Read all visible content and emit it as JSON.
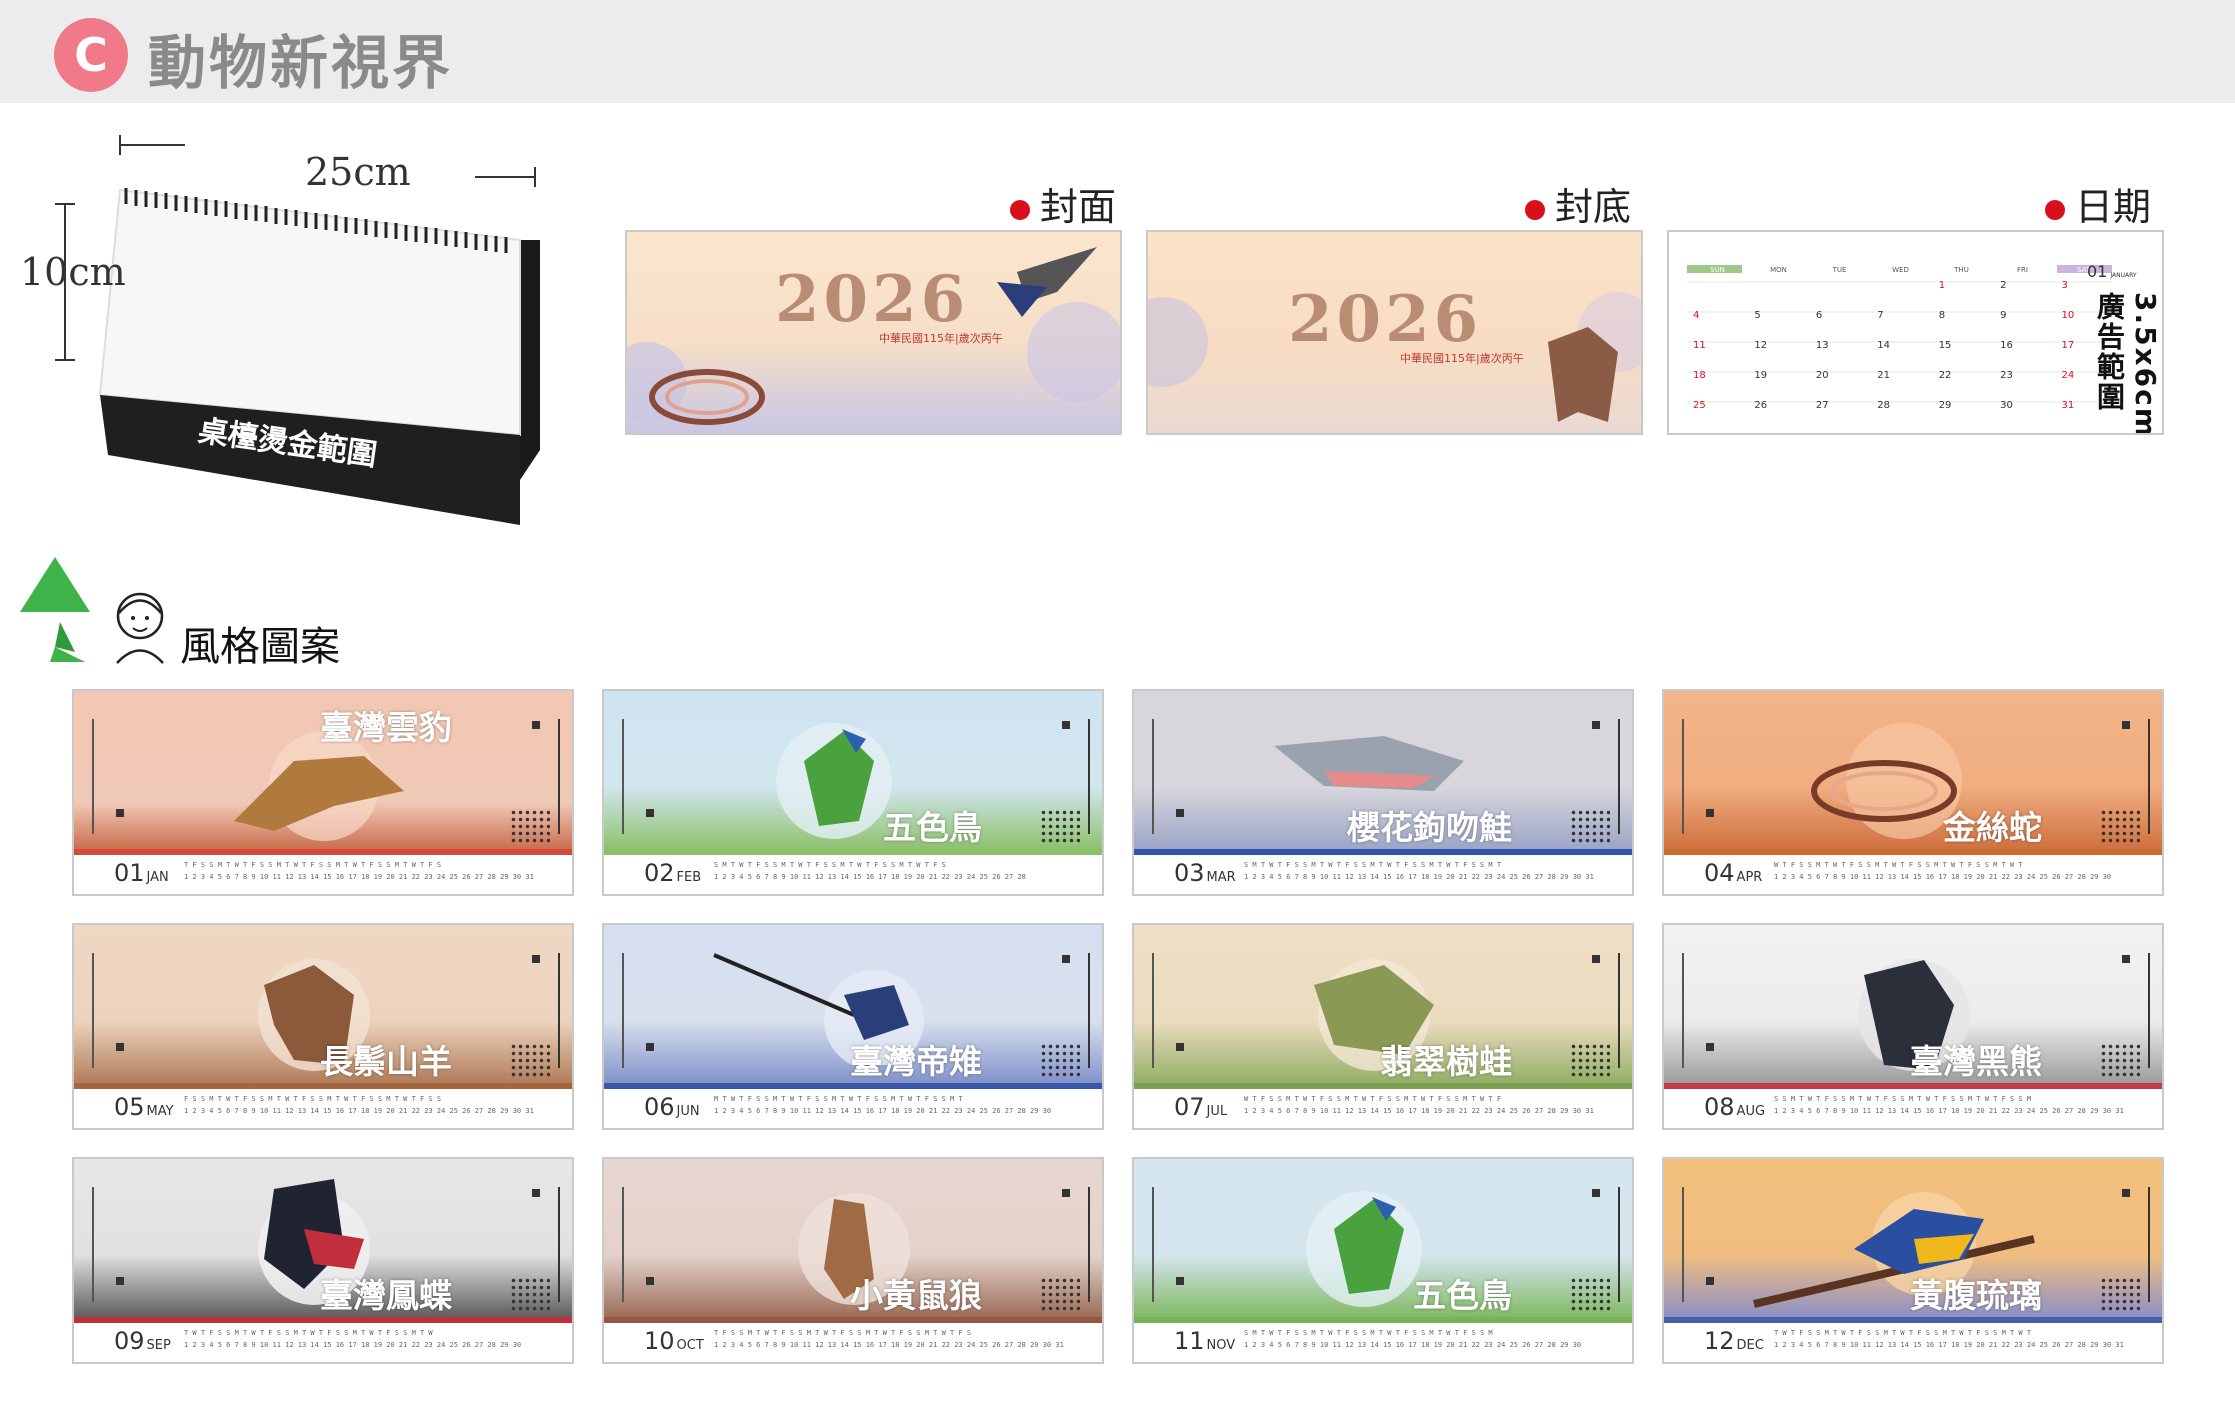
{
  "header": {
    "badge": "C",
    "title": "動物新視界"
  },
  "desk": {
    "width_label": "25cm",
    "height_label": "10cm",
    "foil_label": "桌檯燙金範圍"
  },
  "sections": {
    "cover_label": "封面",
    "back_label": "封底",
    "date_label": "日期",
    "style_label": "風格圖案"
  },
  "cover": {
    "year": "2026",
    "subtitle": "中華民國115年|歲次丙午"
  },
  "back": {
    "year": "2026",
    "subtitle": "中華民國115年|歲次丙午"
  },
  "date_panel": {
    "month": "01",
    "month_en": "JANUARY",
    "weekdays": [
      "SUN",
      "MON",
      "TUE",
      "WED",
      "THU",
      "FRI",
      "SAT"
    ],
    "weeks": [
      [
        "",
        "",
        "",
        "",
        "1",
        "2",
        "3"
      ],
      [
        "4",
        "5",
        "6",
        "7",
        "8",
        "9",
        "10"
      ],
      [
        "11",
        "12",
        "13",
        "14",
        "15",
        "16",
        "17"
      ],
      [
        "18",
        "19",
        "20",
        "21",
        "22",
        "23",
        "24"
      ],
      [
        "25",
        "26",
        "27",
        "28",
        "29",
        "30",
        "31"
      ]
    ],
    "ad_label": "3.5x6cm 廣告範圍"
  },
  "months": [
    {
      "num": "01",
      "mon": "JAN",
      "title": "臺灣雲豹",
      "bg": "#f3c7b3",
      "stripe": "#d24a3b"
    },
    {
      "num": "02",
      "mon": "FEB",
      "title": "五色鳥",
      "bg": "#cfe4f0",
      "stripe": "#8cc06a"
    },
    {
      "num": "03",
      "mon": "MAR",
      "title": "櫻花鉤吻鮭",
      "bg": "#d8d6dc",
      "stripe": "#3355a5"
    },
    {
      "num": "04",
      "mon": "APR",
      "title": "金絲蛇",
      "bg": "#f2b489",
      "stripe": "#c96a2e"
    },
    {
      "num": "05",
      "mon": "MAY",
      "title": "長鬃山羊",
      "bg": "#efd8c3",
      "stripe": "#a5663f"
    },
    {
      "num": "06",
      "mon": "JUN",
      "title": "臺灣帝雉",
      "bg": "#d6dff0",
      "stripe": "#3a56a8"
    },
    {
      "num": "07",
      "mon": "JUL",
      "title": "翡翠樹蛙",
      "bg": "#eedfc5",
      "stripe": "#7ea050"
    },
    {
      "num": "08",
      "mon": "AUG",
      "title": "臺灣黑熊",
      "bg": "#ececec",
      "stripe": "#c23a4b"
    },
    {
      "num": "09",
      "mon": "SEP",
      "title": "臺灣鳳蝶",
      "bg": "#e4e2e2",
      "stripe": "#c12f3c"
    },
    {
      "num": "10",
      "mon": "OCT",
      "title": "小黃鼠狼",
      "bg": "#e8d7d0",
      "stripe": "#9a5540"
    },
    {
      "num": "11",
      "mon": "NOV",
      "title": "五色鳥",
      "bg": "#d5e6f0",
      "stripe": "#78b25a"
    },
    {
      "num": "12",
      "mon": "DEC",
      "title": "黃腹琉璃",
      "bg": "#f4c07d",
      "stripe": "#4b5ea8"
    }
  ],
  "colors": {
    "accent": "#f07a8a",
    "dot": "#d8101b",
    "header_bg": "#ececec"
  }
}
